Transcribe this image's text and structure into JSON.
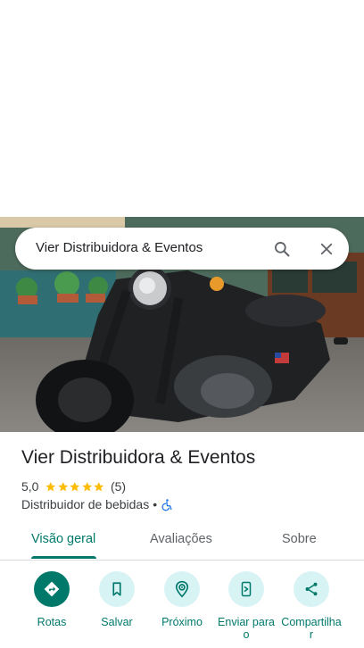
{
  "search": {
    "query": "Vier Distribuidora & Eventos"
  },
  "place": {
    "title": "Vier Distribuidora & Eventos",
    "rating": "5,0",
    "rating_value": 5,
    "review_count": "(5)",
    "category": "Distribuidor de bebidas",
    "separator": "•"
  },
  "tabs": [
    {
      "label": "Visão geral",
      "active": true
    },
    {
      "label": "Avaliações",
      "active": false
    },
    {
      "label": "Sobre",
      "active": false
    }
  ],
  "actions": [
    {
      "label": "Rotas",
      "icon": "directions-icon"
    },
    {
      "label": "Salvar",
      "icon": "bookmark-icon"
    },
    {
      "label": "Próximo",
      "icon": "nearby-icon"
    },
    {
      "label": "Enviar para o",
      "icon": "send-to-phone-icon"
    },
    {
      "label": "Compartilha r",
      "icon": "share-icon"
    }
  ],
  "colors": {
    "accent": "#00796b",
    "action_bg": "#d8f3f4",
    "star": "#fbbc04",
    "accessibility": "#1a73e8"
  }
}
